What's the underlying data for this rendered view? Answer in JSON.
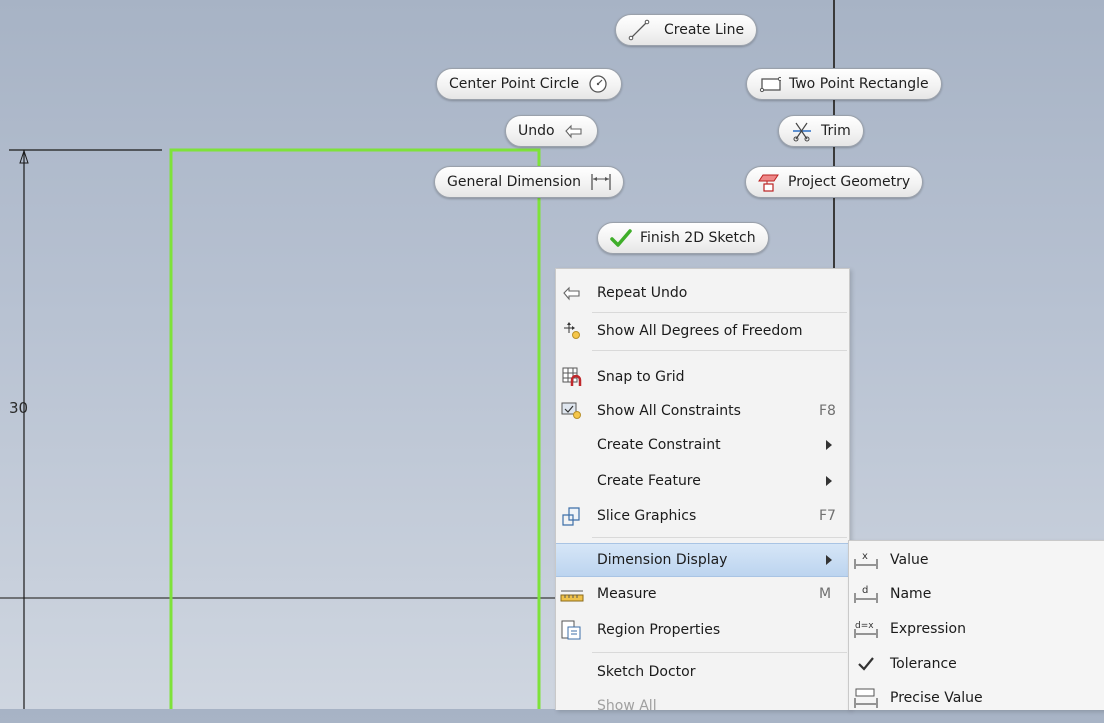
{
  "sketch": {
    "dimension_value": "30"
  },
  "marking_menu": {
    "create_line": "Create Line",
    "center_point_circle": "Center Point Circle",
    "two_point_rectangle": "Two Point Rectangle",
    "undo": "Undo",
    "trim": "Trim",
    "general_dimension": "General Dimension",
    "project_geometry": "Project Geometry",
    "finish_2d_sketch": "Finish 2D Sketch"
  },
  "context_menu": {
    "items": [
      {
        "label": "Repeat Undo",
        "icon": "undo-icon"
      },
      {
        "label": "Show All Degrees of Freedom",
        "icon": "degrees-of-freedom-icon"
      },
      {
        "label": "Snap to Grid",
        "icon": "snap-grid-icon"
      },
      {
        "label": "Show All Constraints",
        "icon": "constraints-icon",
        "shortcut": "F8"
      },
      {
        "label": "Create Constraint",
        "submenu": true
      },
      {
        "label": "Create Feature",
        "submenu": true
      },
      {
        "label": "Slice Graphics",
        "icon": "slice-graphics-icon",
        "shortcut": "F7"
      },
      {
        "label": "Dimension Display",
        "submenu": true,
        "highlighted": true
      },
      {
        "label": "Measure",
        "icon": "measure-icon",
        "shortcut": "M"
      },
      {
        "label": "Region Properties",
        "icon": "region-properties-icon"
      },
      {
        "label": "Sketch Doctor"
      },
      {
        "label": "Show All",
        "disabled": true
      }
    ]
  },
  "dimension_display_submenu": {
    "items": [
      {
        "label": "Value",
        "icon": "dim-value-icon"
      },
      {
        "label": "Name",
        "icon": "dim-name-icon"
      },
      {
        "label": "Expression",
        "icon": "dim-expression-icon"
      },
      {
        "label": "Tolerance",
        "icon": "checkmark-icon",
        "checked": true
      },
      {
        "label": "Precise Value",
        "icon": "precise-value-icon"
      }
    ]
  },
  "colors": {
    "sketch_line": "#7ee23a",
    "menu_highlight": "#c8dcf2",
    "finish_check": "#3fae2a"
  }
}
